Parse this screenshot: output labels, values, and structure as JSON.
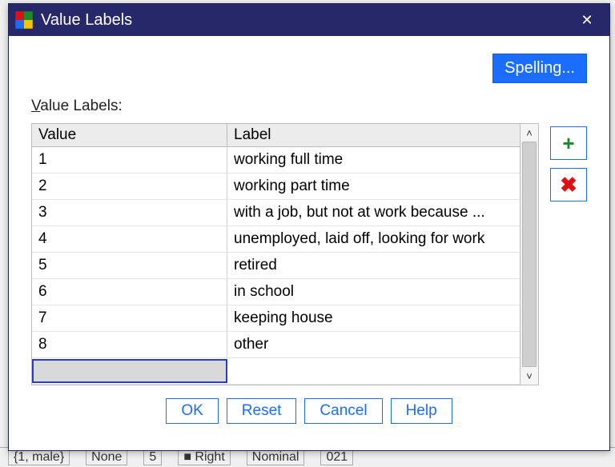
{
  "titlebar": {
    "title": "Value Labels"
  },
  "buttons": {
    "spelling": "Spelling...",
    "ok": "OK",
    "reset": "Reset",
    "cancel": "Cancel",
    "help": "Help"
  },
  "section": {
    "label_prefix": "V",
    "label_rest": "alue Labels:"
  },
  "table": {
    "headers": {
      "value": "Value",
      "label": "Label"
    },
    "rows": [
      {
        "value": "1",
        "label": "working full time"
      },
      {
        "value": "2",
        "label": "working part time"
      },
      {
        "value": "3",
        "label": "with a job, but not at work because ..."
      },
      {
        "value": "4",
        "label": "unemployed, laid off, looking for work"
      },
      {
        "value": "5",
        "label": "retired"
      },
      {
        "value": "6",
        "label": "in school"
      },
      {
        "value": "7",
        "label": "keeping house"
      },
      {
        "value": "8",
        "label": "other"
      }
    ]
  },
  "icons": {
    "add": "+",
    "remove": "✖",
    "close": "✕",
    "scroll_up": "˄",
    "scroll_down": "˅"
  },
  "colors": {
    "accent": "#1a6dff",
    "titlebar": "#27286a",
    "add": "#1a8a2e",
    "remove": "#d11"
  },
  "background_hints": [
    "{1, male}",
    "None",
    "5",
    "■ Right",
    "Nominal",
    "021"
  ]
}
